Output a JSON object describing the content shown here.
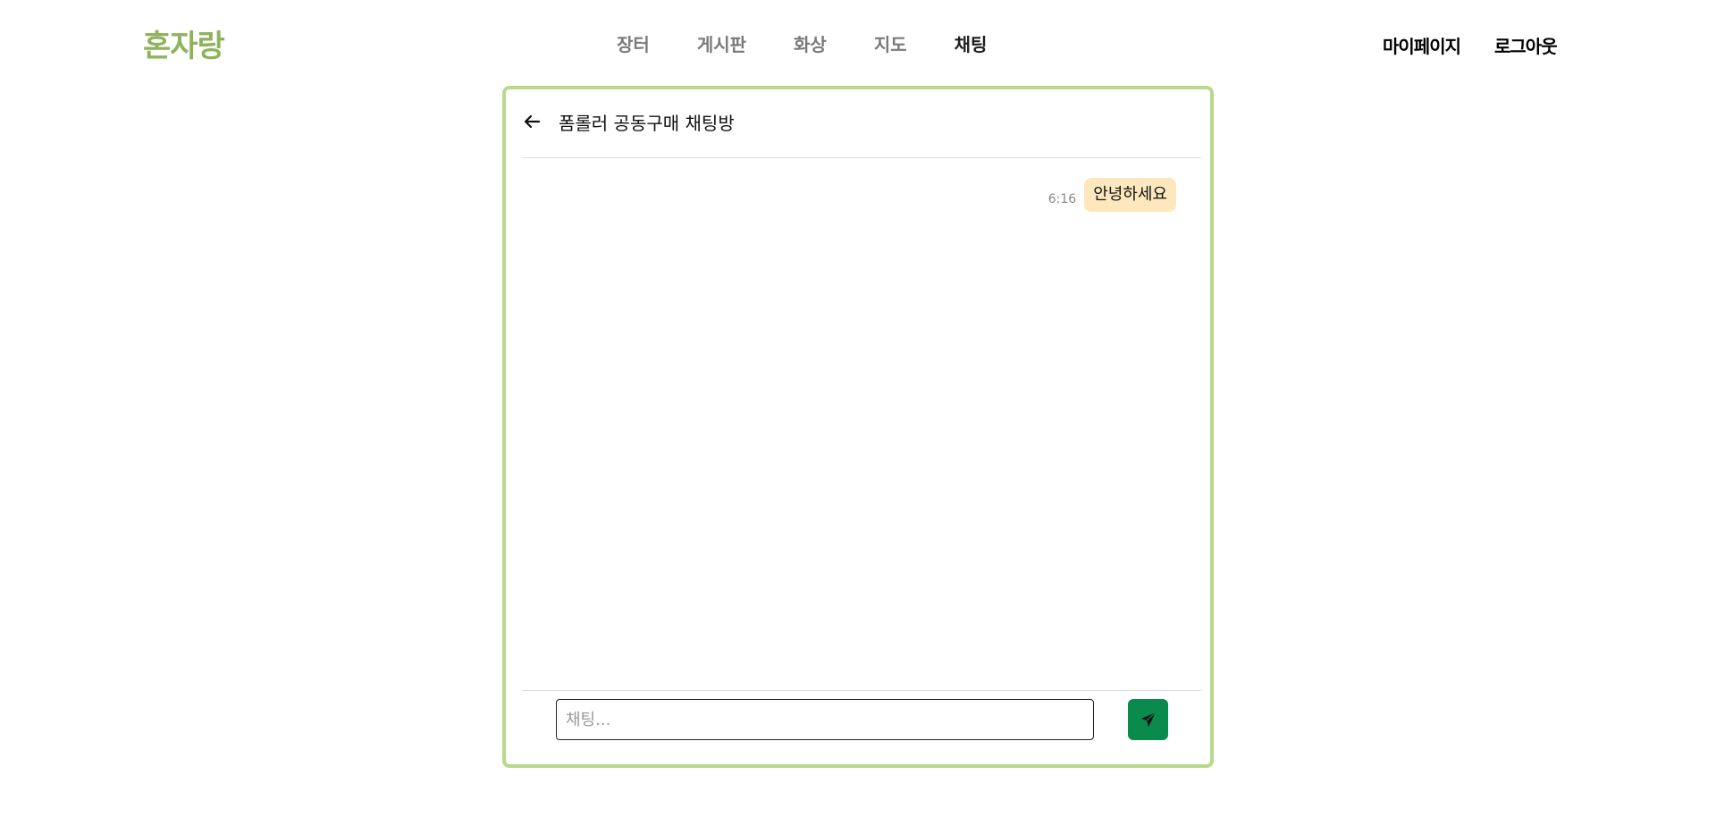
{
  "app": {
    "logo": "혼자랑"
  },
  "nav": {
    "items": [
      {
        "label": "장터",
        "active": false
      },
      {
        "label": "게시판",
        "active": false
      },
      {
        "label": "화상",
        "active": false
      },
      {
        "label": "지도",
        "active": false
      },
      {
        "label": "채팅",
        "active": true
      }
    ]
  },
  "user_menu": {
    "mypage_label": "마이페이지",
    "logout_label": "로그아웃"
  },
  "chat": {
    "back_icon": "arrow-left-icon",
    "room_title": "폼롤러 공동구매 채팅방",
    "messages": [
      {
        "time": "6:16",
        "text": "안녕하세요",
        "mine": true
      }
    ],
    "input": {
      "value": "",
      "placeholder": "채팅..."
    },
    "send_icon": "paper-plane-icon"
  },
  "colors": {
    "brand": "#8fb35c",
    "card_border": "#b8d98a",
    "bubble": "#fde8bd",
    "send_button": "#0a8a4c",
    "nav_inactive": "#7a7a7a",
    "nav_active": "#1e1e1e"
  }
}
